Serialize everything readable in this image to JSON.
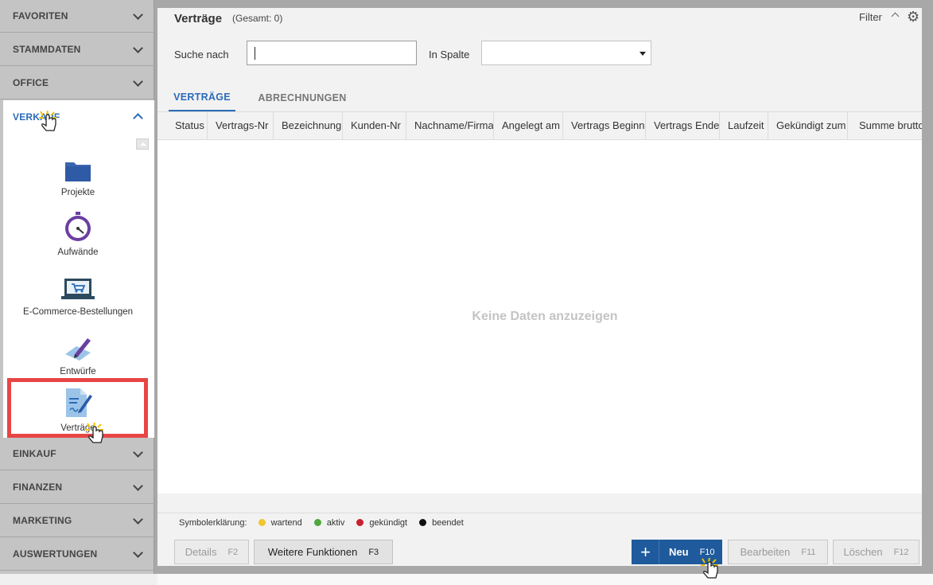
{
  "sidebar": {
    "sections": [
      {
        "label": "FAVORITEN",
        "expanded": false
      },
      {
        "label": "STAMMDATEN",
        "expanded": false
      },
      {
        "label": "OFFICE",
        "expanded": false
      },
      {
        "label": "VERKAUF",
        "expanded": true
      },
      {
        "label": "EINKAUF",
        "expanded": false
      },
      {
        "label": "FINANZEN",
        "expanded": false
      },
      {
        "label": "MARKETING",
        "expanded": false
      },
      {
        "label": "AUSWERTUNGEN",
        "expanded": false
      }
    ],
    "verkauf_items": [
      {
        "label": "Projekte",
        "icon": "folder-icon"
      },
      {
        "label": "Aufwände",
        "icon": "stopwatch-icon"
      },
      {
        "label": "E-Commerce-Bestellungen",
        "icon": "laptop-cart-icon"
      },
      {
        "label": "Entwürfe",
        "icon": "pen-draft-icon"
      },
      {
        "label": "Verträge",
        "icon": "contract-icon",
        "highlighted": true
      }
    ]
  },
  "header": {
    "title": "Verträge",
    "count": "(Gesamt: 0)",
    "filter_label": "Filter"
  },
  "search": {
    "label": "Suche nach",
    "value": "",
    "column_label": "In Spalte",
    "column_value": ""
  },
  "tabs": [
    {
      "label": "VERTRÄGE",
      "active": true
    },
    {
      "label": "ABRECHNUNGEN",
      "active": false
    }
  ],
  "grid": {
    "columns": [
      "Status",
      "Vertrags-Nr",
      "Bezeichnung",
      "Kunden-Nr",
      "Nachname/Firma",
      "Angelegt am",
      "Vertrags Beginn",
      "Vertrags Ende",
      "Laufzeit",
      "Gekündigt zum",
      "Summe brutto"
    ],
    "empty_message": "Keine Daten anzuzeigen"
  },
  "legend": {
    "title": "Symbolerklärung:",
    "items": [
      {
        "label": "wartend",
        "color": "#f2c52e"
      },
      {
        "label": "aktiv",
        "color": "#4fa83d"
      },
      {
        "label": "gekündigt",
        "color": "#c8202f"
      },
      {
        "label": "beendet",
        "color": "#111111"
      }
    ]
  },
  "footer_buttons": {
    "details": {
      "label": "Details",
      "key": "F2"
    },
    "more": {
      "label": "Weitere Funktionen",
      "key": "F3"
    },
    "new": {
      "label": "Neu",
      "key": "F10"
    },
    "edit": {
      "label": "Bearbeiten",
      "key": "F11"
    },
    "delete": {
      "label": "Löschen",
      "key": "F12"
    }
  },
  "colors": {
    "accent": "#2a6bb8",
    "primary_button": "#1f5a9c",
    "highlight": "#e84545"
  }
}
